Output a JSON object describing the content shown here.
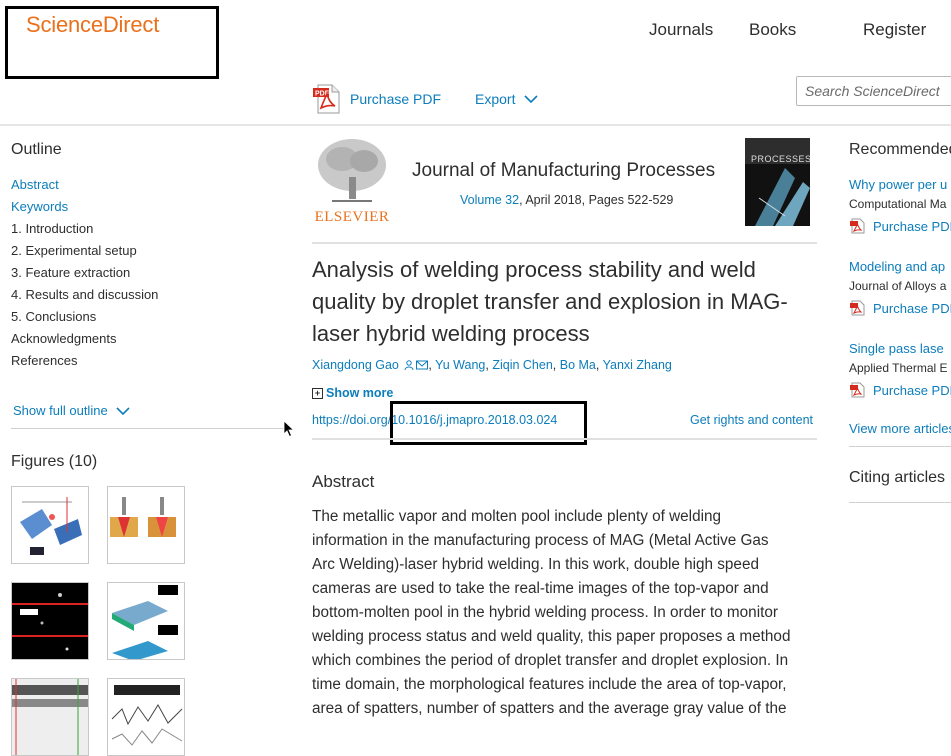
{
  "header": {
    "logo_text": "ScienceDirect",
    "nav": {
      "journals": "Journals",
      "books": "Books",
      "register": "Register"
    },
    "toolbar": {
      "purchase_pdf": "Purchase PDF",
      "export": "Export"
    },
    "search": {
      "placeholder": "Search ScienceDirect"
    }
  },
  "outline": {
    "title": "Outline",
    "items": [
      {
        "label": "Abstract",
        "link": true
      },
      {
        "label": "Keywords",
        "link": true
      },
      {
        "label": "1. Introduction",
        "link": false
      },
      {
        "label": "2. Experimental setup",
        "link": false
      },
      {
        "label": "3. Feature extraction",
        "link": false
      },
      {
        "label": "4. Results and discussion",
        "link": false
      },
      {
        "label": "5. Conclusions",
        "link": false
      },
      {
        "label": "Acknowledgments",
        "link": false
      },
      {
        "label": "References",
        "link": false
      }
    ],
    "show_full": "Show full outline"
  },
  "figures": {
    "title": "Figures (10)"
  },
  "article": {
    "publisher_logo_text": "ELSEVIER",
    "journal": "Journal of Manufacturing Processes",
    "volume_link": "Volume 32",
    "volume_rest": ", April 2018, Pages 522-529",
    "cover_text": "PROCESSES",
    "title": "Analysis of welding process stability and weld quality by droplet transfer and explosion in MAG-laser hybrid welding process",
    "authors": [
      "Xiangdong Gao",
      "Yu Wang",
      "Ziqin Chen",
      "Bo Ma",
      "Yanxi Zhang"
    ],
    "show_more": "Show more",
    "doi": "https://doi.org/10.1016/j.jmapro.2018.03.024",
    "rights": "Get rights and content",
    "abstract_heading": "Abstract",
    "abstract_lines": [
      "The metallic vapor and molten pool include plenty of welding",
      "information in the manufacturing process of MAG (Metal Active Gas",
      "Arc Welding)-laser hybrid welding. In this work, double high speed",
      "cameras are used to take the real-time images of the top-vapor and",
      "bottom-molten pool in the hybrid welding process. In order to monitor",
      "welding process status and weld quality, this paper proposes a method",
      "which combines the period of droplet transfer and droplet explosion. In",
      "time domain, the morphological features include the area of top-vapor,",
      "area of spatters, number of spatters and the average gray value of the"
    ]
  },
  "recommended": {
    "title": "Recommended",
    "items": [
      {
        "title": "Why power per u",
        "journal": "Computational Ma",
        "pdf": "Purchase PDF"
      },
      {
        "title": "Modeling and ap",
        "journal": "Journal of Alloys a",
        "pdf": "Purchase PDF"
      },
      {
        "title": "Single pass lase",
        "journal": "Applied Thermal E",
        "pdf": "Purchase PDF"
      }
    ],
    "view_more": "View more articles",
    "citing": "Citing articles"
  },
  "colors": {
    "link": "#0c7dbb",
    "brand": "#e9711c",
    "text": "#2e2e2e",
    "pdf_red": "#d52b1e"
  }
}
